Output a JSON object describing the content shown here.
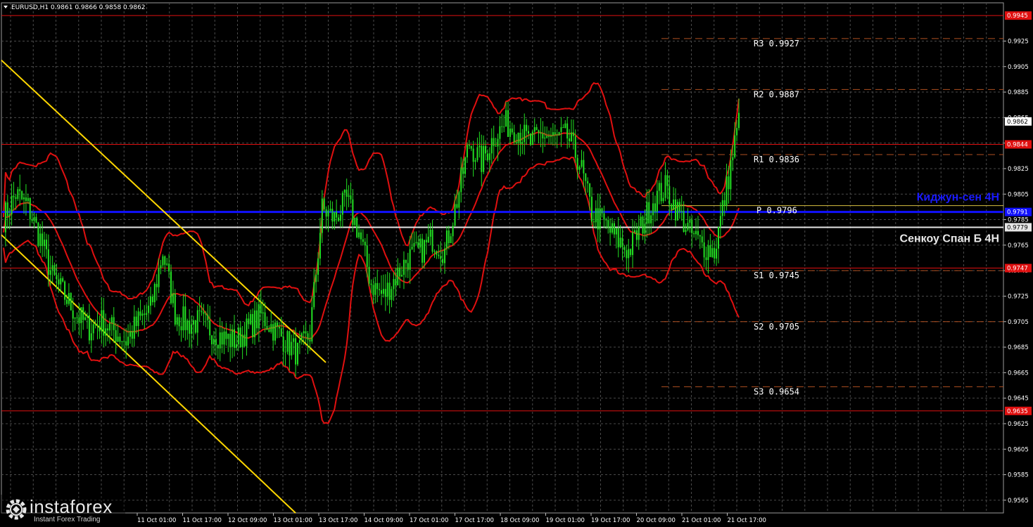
{
  "header": {
    "symbol_line": "EURUSD,H1  0.9861 0.9866 0.9858 0.9862"
  },
  "logo": {
    "brand": "instaforex",
    "tagline": "Instant Forex Trading"
  },
  "colors": {
    "background": "#000000",
    "grid": "#4a4a4a",
    "candle": "#22e022",
    "bands": "#e01010",
    "trendlines": "#ffd700",
    "level_red": "#e01010",
    "kijun": "#1010ff",
    "senkou": "#e6e6e6",
    "pivot": "#b05020"
  },
  "chart_data": {
    "type": "candlestick",
    "timeframe": "H1",
    "ylim": [
      0.9555,
      0.9955
    ],
    "time_ticks": [
      "11 Oct 01:00",
      "11 Oct 17:00",
      "12 Oct 09:00",
      "13 Oct 01:00",
      "13 Oct 17:00",
      "14 Oct 09:00",
      "17 Oct 01:00",
      "17 Oct 17:00",
      "18 Oct 09:00",
      "19 Oct 01:00",
      "19 Oct 17:00",
      "20 Oct 09:00",
      "21 Oct 01:00",
      "21 Oct 17:00"
    ],
    "price_ticks": [
      "0.9925",
      "0.9905",
      "0.9885",
      "0.9865",
      "0.9845",
      "0.9825",
      "0.9805",
      "0.9785",
      "0.9765",
      "0.9745",
      "0.9725",
      "0.9705",
      "0.9685",
      "0.9665",
      "0.9645",
      "0.9625",
      "0.9605",
      "0.9585",
      "0.9565"
    ],
    "price_tags": [
      {
        "label": "0.9945",
        "value": 0.9945,
        "color": "#e01010"
      },
      {
        "label": "0.9862",
        "value": 0.9862,
        "color": "#ffffff"
      },
      {
        "label": "0.9844",
        "value": 0.9844,
        "color": "#e01010"
      },
      {
        "label": "0.9791",
        "value": 0.9791,
        "color": "#1010ff"
      },
      {
        "label": "0.9779",
        "value": 0.9779,
        "color": "#e6e6e6"
      },
      {
        "label": "0.9747",
        "value": 0.9747,
        "color": "#e01010"
      },
      {
        "label": "0.9635",
        "value": 0.9635,
        "color": "#e01010"
      }
    ],
    "levels": [
      {
        "name": "resistance-0.9945",
        "value": 0.9945,
        "color": "#e01010"
      },
      {
        "name": "resistance-0.9844",
        "value": 0.9844,
        "color": "#e01010"
      },
      {
        "name": "kijun-sen",
        "value": 0.9791,
        "color": "#1010ff"
      },
      {
        "name": "senkou-span-b",
        "value": 0.9779,
        "color": "#e6e6e6"
      },
      {
        "name": "support-0.9747",
        "value": 0.9747,
        "color": "#e01010"
      },
      {
        "name": "support-0.9635",
        "value": 0.9635,
        "color": "#e01010"
      }
    ],
    "pivots": [
      {
        "label": "R3",
        "value": 0.9927,
        "text": "0.9927"
      },
      {
        "label": "R2",
        "value": 0.9887,
        "text": "0.9887"
      },
      {
        "label": "R1",
        "value": 0.9836,
        "text": "0.9836"
      },
      {
        "label": "P",
        "value": 0.9796,
        "text": "0.9796"
      },
      {
        "label": "S1",
        "value": 0.9745,
        "text": "0.9745"
      },
      {
        "label": "S2",
        "value": 0.9705,
        "text": "0.9705"
      },
      {
        "label": "S3",
        "value": 0.9654,
        "text": "0.9654"
      }
    ],
    "annotations": {
      "kijun": "Киджун-сен 4Н",
      "senkou": "Сенкоу Спан Б 4Н"
    },
    "close_path": [
      [
        0,
        0.9786
      ],
      [
        6,
        0.9805
      ],
      [
        12,
        0.9795
      ],
      [
        18,
        0.977
      ],
      [
        24,
        0.974
      ],
      [
        30,
        0.9725
      ],
      [
        36,
        0.971
      ],
      [
        42,
        0.97
      ],
      [
        48,
        0.9705
      ],
      [
        54,
        0.9698
      ],
      [
        60,
        0.969
      ],
      [
        66,
        0.9705
      ],
      [
        72,
        0.9715
      ],
      [
        78,
        0.976
      ],
      [
        84,
        0.9712
      ],
      [
        90,
        0.9703
      ],
      [
        96,
        0.9705
      ],
      [
        102,
        0.9698
      ],
      [
        108,
        0.9692
      ],
      [
        114,
        0.969
      ],
      [
        120,
        0.97
      ],
      [
        126,
        0.971
      ],
      [
        132,
        0.97
      ],
      [
        138,
        0.969
      ],
      [
        144,
        0.968
      ],
      [
        150,
        0.9695
      ],
      [
        156,
        0.9793
      ],
      [
        162,
        0.9786
      ],
      [
        168,
        0.98
      ],
      [
        174,
        0.9775
      ],
      [
        180,
        0.9735
      ],
      [
        186,
        0.9725
      ],
      [
        192,
        0.974
      ],
      [
        198,
        0.9755
      ],
      [
        204,
        0.976
      ],
      [
        210,
        0.977
      ],
      [
        216,
        0.976
      ],
      [
        222,
        0.98
      ],
      [
        228,
        0.9845
      ],
      [
        234,
        0.983
      ],
      [
        240,
        0.985
      ],
      [
        246,
        0.986
      ],
      [
        252,
        0.9855
      ],
      [
        258,
        0.9845
      ],
      [
        264,
        0.9852
      ],
      [
        270,
        0.9848
      ],
      [
        276,
        0.985
      ],
      [
        282,
        0.983
      ],
      [
        288,
        0.979
      ],
      [
        294,
        0.9782
      ],
      [
        300,
        0.977
      ],
      [
        306,
        0.976
      ],
      [
        312,
        0.9779
      ],
      [
        318,
        0.98
      ],
      [
        324,
        0.981
      ],
      [
        330,
        0.9792
      ],
      [
        336,
        0.9775
      ],
      [
        342,
        0.9765
      ],
      [
        348,
        0.976
      ],
      [
        354,
        0.981
      ],
      [
        360,
        0.9862
      ]
    ]
  }
}
